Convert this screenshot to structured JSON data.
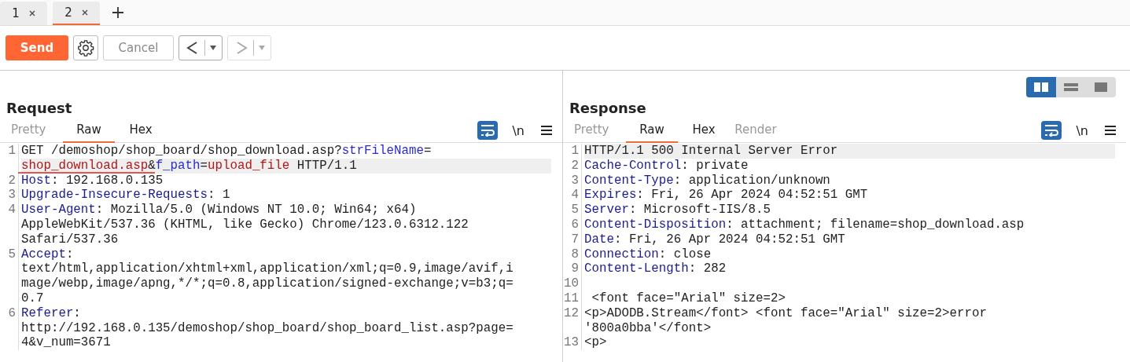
{
  "session_tabs": [
    {
      "label": "1",
      "selected": false
    },
    {
      "label": "2",
      "selected": true
    }
  ],
  "toolbar": {
    "send": "Send",
    "cancel": "Cancel"
  },
  "layout_modes": [
    {
      "kind": "columns",
      "selected": true
    },
    {
      "kind": "rows",
      "selected": false
    },
    {
      "kind": "single",
      "selected": false
    }
  ],
  "request": {
    "title": "Request",
    "view_tabs": [
      {
        "label": "Pretty",
        "selected": false,
        "disabled": true
      },
      {
        "label": "Raw",
        "selected": true,
        "disabled": false
      },
      {
        "label": "Hex",
        "selected": false,
        "disabled": false
      }
    ],
    "wrap_on": true,
    "newline_label": "\\n",
    "lines": [
      {
        "number": "1",
        "rows": [
          {
            "highlighted": false,
            "segments": [
              {
                "kind": "plain",
                "text": "GET /demoshop/shop_board/shop_download.asp?"
              },
              {
                "kind": "param",
                "text": "strFileName"
              },
              {
                "kind": "plain",
                "text": "="
              }
            ]
          },
          {
            "highlighted": true,
            "segments": [
              {
                "kind": "value",
                "text": "shop_download.asp"
              },
              {
                "kind": "plain",
                "text": "&"
              },
              {
                "kind": "param",
                "text": "f_path"
              },
              {
                "kind": "plain",
                "text": "="
              },
              {
                "kind": "value",
                "text": "upload_file"
              },
              {
                "kind": "plain",
                "text": " HTTP/1.1"
              }
            ]
          }
        ]
      },
      {
        "number": "2",
        "rows": [
          {
            "highlighted": false,
            "segments": [
              {
                "kind": "name",
                "text": "Host"
              },
              {
                "kind": "plain",
                "text": ": 192.168.0.135"
              }
            ]
          }
        ]
      },
      {
        "number": "3",
        "rows": [
          {
            "highlighted": false,
            "segments": [
              {
                "kind": "name",
                "text": "Upgrade-Insecure-Requests"
              },
              {
                "kind": "plain",
                "text": ": 1"
              }
            ]
          }
        ]
      },
      {
        "number": "4",
        "rows": [
          {
            "highlighted": false,
            "segments": [
              {
                "kind": "name",
                "text": "User-Agent"
              },
              {
                "kind": "plain",
                "text": ": Mozilla/5.0 (Windows NT 10.0; Win64; x64)"
              }
            ]
          },
          {
            "highlighted": false,
            "segments": [
              {
                "kind": "plain",
                "text": "AppleWebKit/537.36 (KHTML, like Gecko) Chrome/123.0.6312.122"
              }
            ]
          },
          {
            "highlighted": false,
            "segments": [
              {
                "kind": "plain",
                "text": "Safari/537.36"
              }
            ]
          }
        ]
      },
      {
        "number": "5",
        "rows": [
          {
            "highlighted": false,
            "segments": [
              {
                "kind": "name",
                "text": "Accept"
              },
              {
                "kind": "plain",
                "text": ":"
              }
            ]
          },
          {
            "highlighted": false,
            "segments": [
              {
                "kind": "plain",
                "text": "text/html,application/xhtml+xml,application/xml;q=0.9,image/avif,i"
              }
            ]
          },
          {
            "highlighted": false,
            "segments": [
              {
                "kind": "plain",
                "text": "mage/webp,image/apng,*/*;q=0.8,application/signed-exchange;v=b3;q="
              }
            ]
          },
          {
            "highlighted": false,
            "segments": [
              {
                "kind": "plain",
                "text": "0.7"
              }
            ]
          }
        ]
      },
      {
        "number": "6",
        "rows": [
          {
            "highlighted": false,
            "segments": [
              {
                "kind": "name",
                "text": "Referer"
              },
              {
                "kind": "plain",
                "text": ":"
              }
            ]
          },
          {
            "highlighted": false,
            "segments": [
              {
                "kind": "plain",
                "text": "http://192.168.0.135/demoshop/shop_board/shop_board_list.asp?page="
              }
            ]
          },
          {
            "highlighted": false,
            "segments": [
              {
                "kind": "plain",
                "text": "4&v_num=3671"
              }
            ]
          }
        ]
      }
    ]
  },
  "response": {
    "title": "Response",
    "view_tabs": [
      {
        "label": "Pretty",
        "selected": false,
        "disabled": true
      },
      {
        "label": "Raw",
        "selected": true,
        "disabled": false
      },
      {
        "label": "Hex",
        "selected": false,
        "disabled": false
      },
      {
        "label": "Render",
        "selected": false,
        "disabled": true
      }
    ],
    "wrap_on": true,
    "newline_label": "\\n",
    "lines": [
      {
        "number": "1",
        "rows": [
          {
            "highlighted": true,
            "segments": [
              {
                "kind": "plain",
                "text": "HTTP/1.1 500 Internal Server Error"
              }
            ]
          }
        ]
      },
      {
        "number": "2",
        "rows": [
          {
            "highlighted": false,
            "segments": [
              {
                "kind": "name",
                "text": "Cache-Control"
              },
              {
                "kind": "plain",
                "text": ": private"
              }
            ]
          }
        ]
      },
      {
        "number": "3",
        "rows": [
          {
            "highlighted": false,
            "segments": [
              {
                "kind": "name",
                "text": "Content-Type"
              },
              {
                "kind": "plain",
                "text": ": application/unknown"
              }
            ]
          }
        ]
      },
      {
        "number": "4",
        "rows": [
          {
            "highlighted": false,
            "segments": [
              {
                "kind": "name",
                "text": "Expires"
              },
              {
                "kind": "plain",
                "text": ": Fri, 26 Apr 2024 04:52:51 GMT"
              }
            ]
          }
        ]
      },
      {
        "number": "5",
        "rows": [
          {
            "highlighted": false,
            "segments": [
              {
                "kind": "name",
                "text": "Server"
              },
              {
                "kind": "plain",
                "text": ": Microsoft-IIS/8.5"
              }
            ]
          }
        ]
      },
      {
        "number": "6",
        "rows": [
          {
            "highlighted": false,
            "segments": [
              {
                "kind": "name",
                "text": "Content-Disposition"
              },
              {
                "kind": "plain",
                "text": ": attachment; filename=shop_download.asp"
              }
            ]
          }
        ]
      },
      {
        "number": "7",
        "rows": [
          {
            "highlighted": false,
            "segments": [
              {
                "kind": "name",
                "text": "Date"
              },
              {
                "kind": "plain",
                "text": ": Fri, 26 Apr 2024 04:52:51 GMT"
              }
            ]
          }
        ]
      },
      {
        "number": "8",
        "rows": [
          {
            "highlighted": false,
            "segments": [
              {
                "kind": "name",
                "text": "Connection"
              },
              {
                "kind": "plain",
                "text": ": close"
              }
            ]
          }
        ]
      },
      {
        "number": "9",
        "rows": [
          {
            "highlighted": false,
            "segments": [
              {
                "kind": "name",
                "text": "Content-Length"
              },
              {
                "kind": "plain",
                "text": ": 282"
              }
            ]
          }
        ]
      },
      {
        "number": "10",
        "rows": [
          {
            "highlighted": false,
            "segments": []
          }
        ]
      },
      {
        "number": "11",
        "rows": [
          {
            "highlighted": false,
            "segments": [
              {
                "kind": "plain",
                "text": " <font face=\"Arial\" size=2>"
              }
            ]
          }
        ]
      },
      {
        "number": "12",
        "rows": [
          {
            "highlighted": false,
            "segments": [
              {
                "kind": "plain",
                "text": "<p>ADODB.Stream</font> <font face=\"Arial\" size=2>error"
              }
            ]
          },
          {
            "highlighted": false,
            "segments": [
              {
                "kind": "plain",
                "text": "'800a0bba'</font>"
              }
            ]
          }
        ]
      },
      {
        "number": "13",
        "rows": [
          {
            "highlighted": false,
            "segments": [
              {
                "kind": "plain",
                "text": "<p>"
              }
            ]
          }
        ]
      }
    ]
  }
}
